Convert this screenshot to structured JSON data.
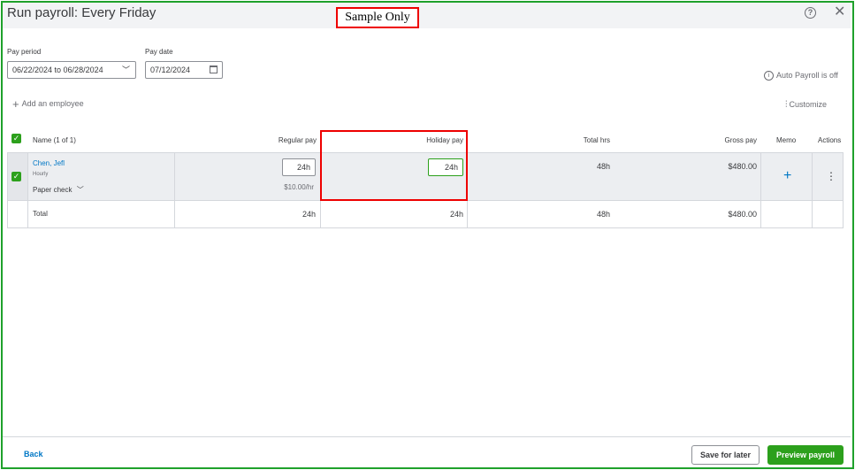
{
  "header": {
    "title": "Run payroll: Every Friday",
    "watermark": "Sample Only"
  },
  "pay_period": {
    "label": "Pay period",
    "value": "06/22/2024 to 06/28/2024"
  },
  "pay_date": {
    "label": "Pay date",
    "value": "07/12/2024"
  },
  "auto_payroll": "Auto Payroll is off",
  "add_employee": "Add an employee",
  "customize": "Customize",
  "table": {
    "headers": {
      "name": "Name (1 of 1)",
      "regular_pay": "Regular pay",
      "holiday_pay": "Holiday pay",
      "total_hrs": "Total hrs",
      "gross_pay": "Gross pay",
      "memo": "Memo",
      "actions": "Actions"
    },
    "employee": {
      "name": "Chen, Jefl",
      "type": "Hourly",
      "payment_method": "Paper check",
      "regular_pay": "24h",
      "rate": "$10.00/hr",
      "holiday_pay": "24h",
      "total_hrs": "48h",
      "gross_pay": "$480.00"
    },
    "total": {
      "label": "Total",
      "regular_pay": "24h",
      "holiday_pay": "24h",
      "total_hrs": "48h",
      "gross_pay": "$480.00"
    }
  },
  "footer": {
    "back": "Back",
    "save_for_later": "Save for later",
    "preview_payroll": "Preview payroll"
  },
  "colors": {
    "accent_green": "#2ca01c",
    "link_blue": "#0077c5",
    "highlight_red": "#e00000"
  }
}
